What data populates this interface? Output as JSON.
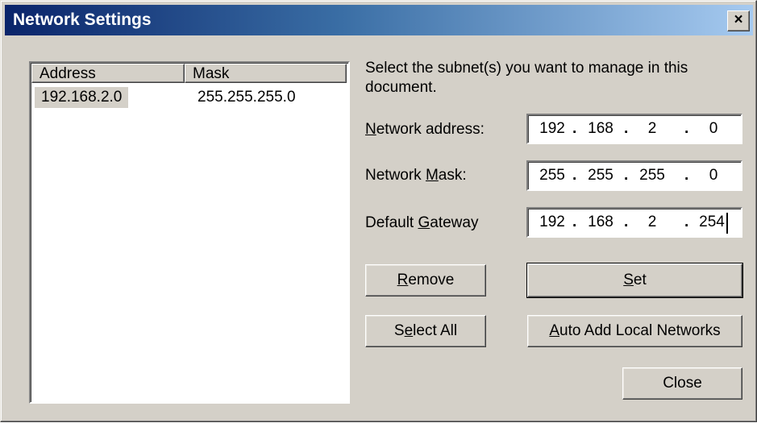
{
  "window": {
    "title": "Network Settings",
    "close_glyph": "×",
    "close_icon": "close-icon"
  },
  "list": {
    "columns": [
      "Address",
      "Mask"
    ],
    "rows": [
      {
        "address": "192.168.2.0",
        "mask": "255.255.255.0",
        "selected": true
      }
    ]
  },
  "description": "Select the subnet(s) you want to manage in this document.",
  "fields": {
    "network_address": {
      "label_mnemonic": "N",
      "label_rest": "etwork address:",
      "octets": [
        "192",
        "168",
        "2",
        "0"
      ]
    },
    "network_mask": {
      "label_pre": "Network ",
      "label_mnemonic": "M",
      "label_rest": "ask:",
      "octets": [
        "255",
        "255",
        "255",
        "0"
      ]
    },
    "default_gateway": {
      "label_pre": "Default ",
      "label_mnemonic": "G",
      "label_rest": "ateway",
      "octets": [
        "192",
        "168",
        "2",
        "254"
      ]
    }
  },
  "buttons": {
    "remove": {
      "mnemonic": "R",
      "rest": "emove"
    },
    "set": {
      "mnemonic": "S",
      "rest": "et"
    },
    "select_all": {
      "pre": "S",
      "mnemonic": "e",
      "rest": "lect All"
    },
    "auto_add": {
      "mnemonic": "A",
      "rest": "uto Add Local Networks"
    },
    "close": "Close"
  },
  "colors": {
    "title_gradient_start": "#0a246a",
    "title_gradient_end": "#a6caf0",
    "face": "#d4d0c8"
  }
}
